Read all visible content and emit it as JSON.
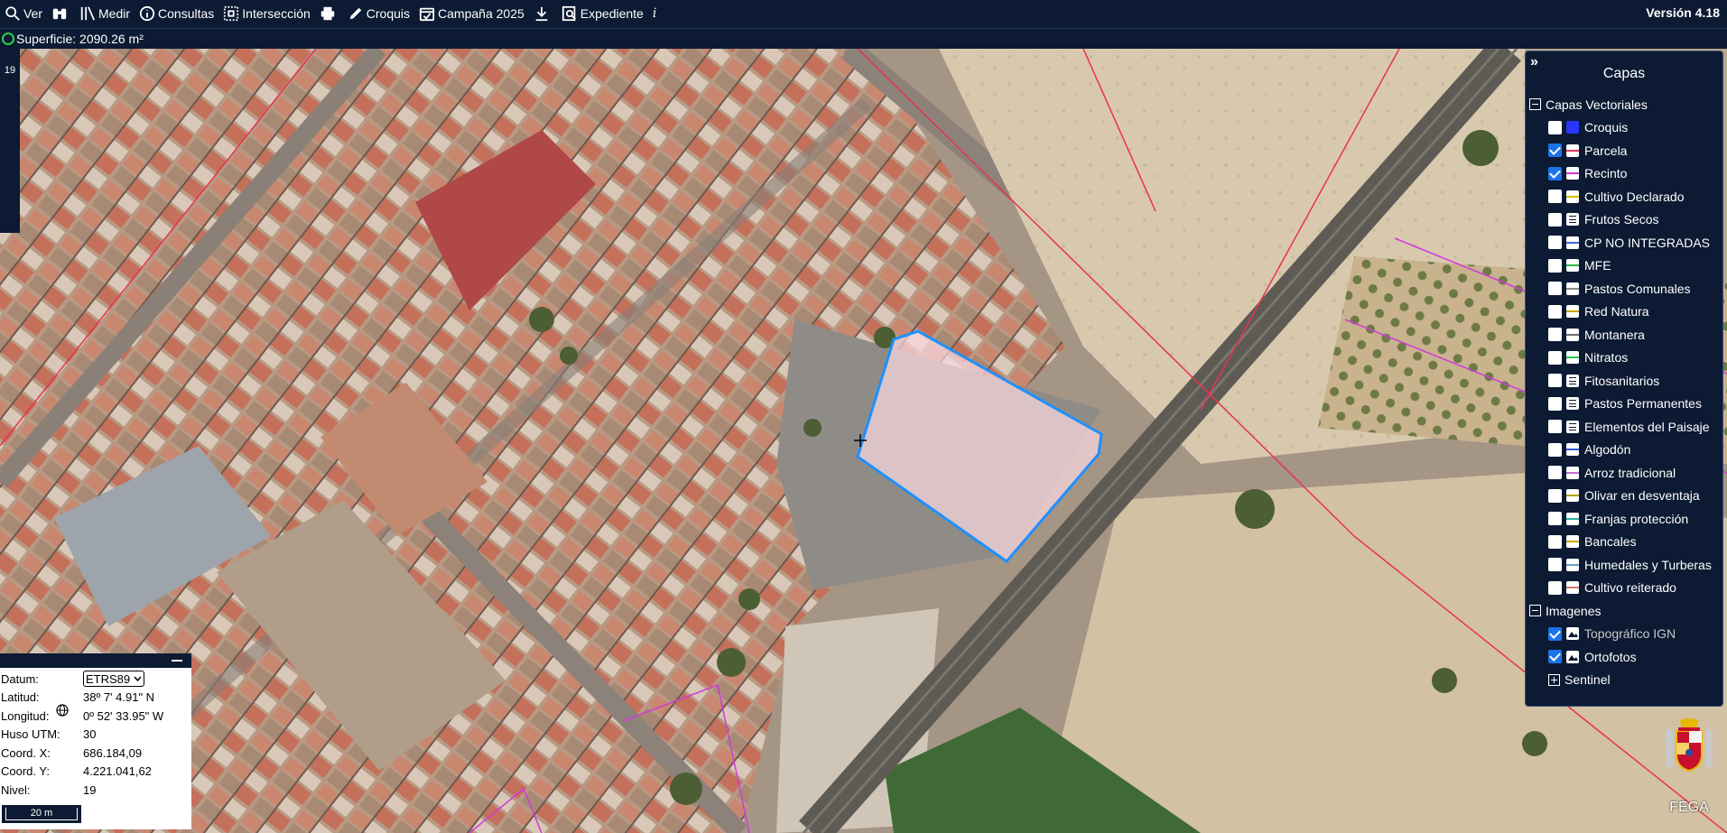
{
  "toolbar": {
    "items": [
      {
        "icon": "magnifier-icon",
        "label": "Ver"
      },
      {
        "icon": "binoculars-icon",
        "label": ""
      },
      {
        "icon": "ruler-icon",
        "label": "Medir"
      },
      {
        "icon": "info-circle-icon",
        "label": "Consultas"
      },
      {
        "icon": "intersection-icon",
        "label": "Intersección"
      },
      {
        "icon": "printer-icon",
        "label": ""
      },
      {
        "icon": "pencil-icon",
        "label": "Croquis"
      },
      {
        "icon": "calendar-check-icon",
        "label": "Campaña 2025"
      },
      {
        "icon": "download-icon",
        "label": ""
      },
      {
        "icon": "search-document-icon",
        "label": "Expediente"
      },
      {
        "icon": "info-italic-icon",
        "label": "i"
      }
    ],
    "version": "Versión 4.18"
  },
  "status": {
    "text": "Superficie: 2090.26 m²",
    "dot_color": "#2bd14a"
  },
  "map": {
    "zoom_level": "19"
  },
  "layers_panel": {
    "collapse_glyph": "»",
    "title": "Capas",
    "vector_group": "Capas Vectoriales",
    "vector_layers": [
      {
        "name": "Croquis",
        "checked": false,
        "swatch": "solid",
        "color": "#2a35ff"
      },
      {
        "name": "Parcela",
        "checked": true,
        "swatch": "line",
        "color": "#e23a55"
      },
      {
        "name": "Recinto",
        "checked": true,
        "swatch": "line",
        "color": "#d03ad6"
      },
      {
        "name": "Cultivo Declarado",
        "checked": false,
        "swatch": "line",
        "color": "#d4c200"
      },
      {
        "name": "Frutos Secos",
        "checked": false,
        "swatch": "lines",
        "color": ""
      },
      {
        "name": "CP NO INTEGRADAS",
        "checked": false,
        "swatch": "line",
        "color": "#3a6ad6"
      },
      {
        "name": "MFE",
        "checked": false,
        "swatch": "line",
        "color": "#2fb84a"
      },
      {
        "name": "Pastos Comunales",
        "checked": false,
        "swatch": "line",
        "color": "#8a8a8a"
      },
      {
        "name": "Red Natura",
        "checked": false,
        "swatch": "line",
        "color": "#c8a800"
      },
      {
        "name": "Montanera",
        "checked": false,
        "swatch": "line",
        "color": "#6a6a6a"
      },
      {
        "name": "Nitratos",
        "checked": false,
        "swatch": "line",
        "color": "#35c455"
      },
      {
        "name": "Fitosanitarios",
        "checked": false,
        "swatch": "lines",
        "color": ""
      },
      {
        "name": "Pastos Permanentes",
        "checked": false,
        "swatch": "lines",
        "color": ""
      },
      {
        "name": "Elementos del Paisaje",
        "checked": false,
        "swatch": "lines",
        "color": ""
      },
      {
        "name": "Algodón",
        "checked": false,
        "swatch": "line",
        "color": "#2a5bd6"
      },
      {
        "name": "Arroz tradicional",
        "checked": false,
        "swatch": "line",
        "color": "#c46fd6"
      },
      {
        "name": "Olivar en desventaja",
        "checked": false,
        "swatch": "line",
        "color": "#b0a200"
      },
      {
        "name": "Franjas protección",
        "checked": false,
        "swatch": "line",
        "color": "#2ab0a0"
      },
      {
        "name": "Bancales",
        "checked": false,
        "swatch": "line",
        "color": "#c8a400"
      },
      {
        "name": "Humedales y Turberas",
        "checked": false,
        "swatch": "line",
        "color": "#6aa0c8"
      },
      {
        "name": "Cultivo reiterado",
        "checked": false,
        "swatch": "line",
        "color": "#d07a6a"
      }
    ],
    "image_group": "Imagenes",
    "image_layers": [
      {
        "name": "Topográfico IGN",
        "checked": true,
        "muted": true
      },
      {
        "name": "Ortofotos",
        "checked": true,
        "muted": false
      }
    ],
    "sentinel": "Sentinel"
  },
  "coords": {
    "datum_label": "Datum:",
    "datum_value": "ETRS89",
    "lat_label": "Latitud:",
    "lat_value": "38º 7' 4.91\" N",
    "lon_label": "Longitud:",
    "lon_value": "0º 52' 33.95\" W",
    "huso_label": "Huso UTM:",
    "huso_value": "30",
    "x_label": "Coord. X:",
    "x_value": "686.184,09",
    "y_label": "Coord. Y:",
    "y_value": "4.221.041,62",
    "nivel_label": "Nivel:",
    "nivel_value": "19",
    "scale": "20 m"
  },
  "fega": {
    "label": "FEGA"
  }
}
